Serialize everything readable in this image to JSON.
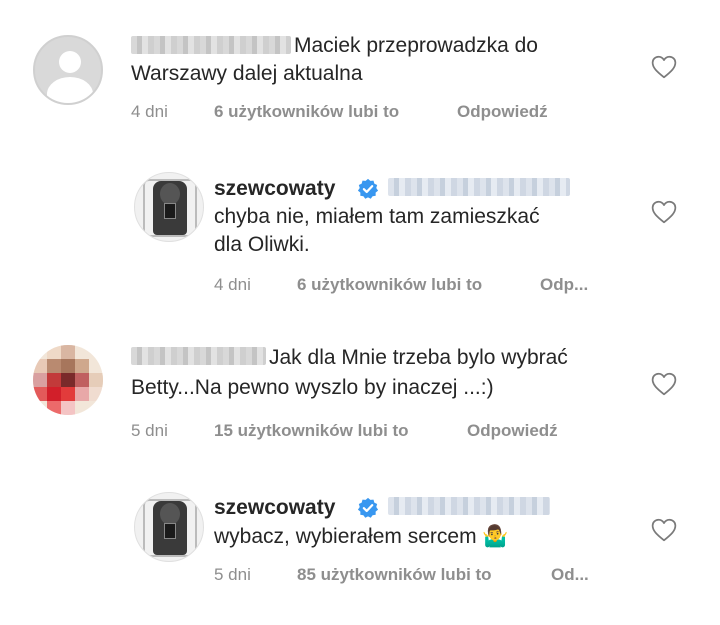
{
  "comments": [
    {
      "text_line1": "Maciek przeprowadzka do",
      "text_line2": "Warszawy dalej aktualna",
      "time": "4 dni",
      "likes": "6 użytkowników lubi to",
      "reply": "Odpowiedź"
    },
    {
      "username": "szewcowaty",
      "text_line1": "chyba nie, miałem tam zamieszkać",
      "text_line2": "dla Oliwki.",
      "time": "4 dni",
      "likes": "6 użytkowników lubi to",
      "reply": "Odp..."
    },
    {
      "text_line1": "Jak dla Mnie trzeba bylo wybrać",
      "text_line2": "Betty...Na pewno wyszlo by inaczej ...:)",
      "time": "5 dni",
      "likes": "15 użytkowników lubi to",
      "reply": "Odpowiedź"
    },
    {
      "username": "szewcowaty",
      "text_line1": "wybacz, wybierałem sercem 🤷‍♂️",
      "time": "5 dni",
      "likes": "85 użytkowników lubi to",
      "reply": "Od..."
    }
  ],
  "icons": {
    "verified": "verified-badge-icon",
    "like": "heart-outline-icon"
  },
  "colors": {
    "text": "#262626",
    "meta": "#8e8e8e",
    "verified": "#3897f0"
  }
}
